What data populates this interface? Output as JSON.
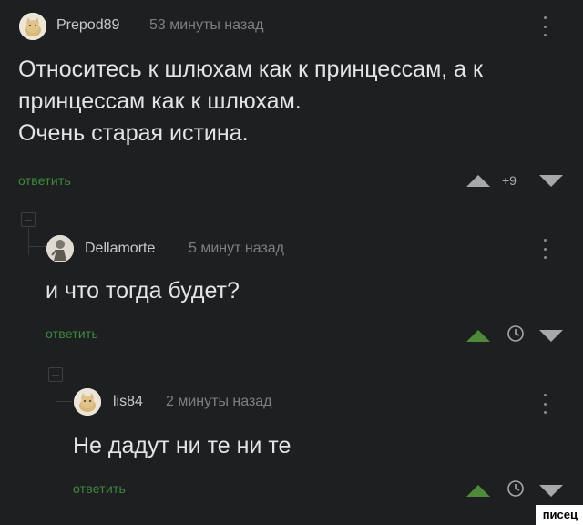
{
  "comments": [
    {
      "author": "Prepod89",
      "time": "53 минуты назад",
      "text": "Относитесь к шлюхам как к принцессам, а к\nпринцессам как к шлюхам.\nОчень старая истина.",
      "reply_label": "ответить",
      "score": "+9",
      "avatar_icon": "avatar-cat-icon"
    },
    {
      "author": "Dellamorte",
      "time": "5 минут назад",
      "text": "и что тогда будет?",
      "reply_label": "ответить",
      "avatar_icon": "avatar-figure-icon",
      "upvoted": true
    },
    {
      "author": "lis84",
      "time": "2 минуты назад",
      "text": "Не дадут ни те ни те",
      "reply_label": "ответить",
      "avatar_icon": "avatar-cat-icon",
      "upvoted": true
    }
  ],
  "watermark": "писец",
  "colors": {
    "background": "#1e1f21",
    "reply": "#3e8a3e",
    "upvote_active": "#4e8a3a",
    "vote_inactive": "#a6a8ab"
  }
}
